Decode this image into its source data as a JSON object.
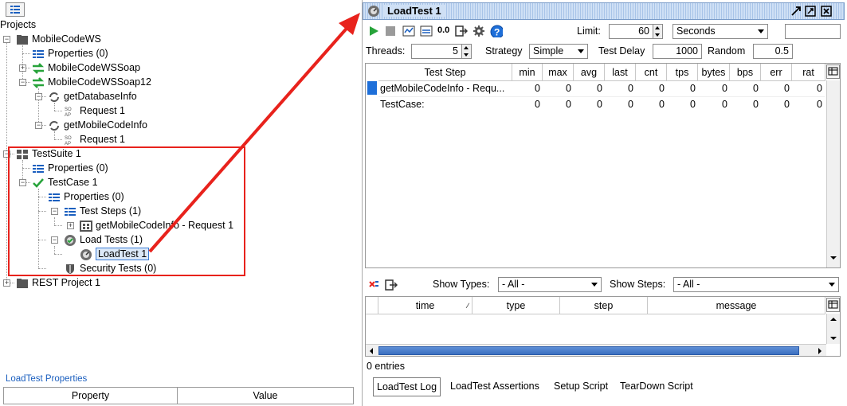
{
  "left": {
    "projects_label": "Projects",
    "tree": [
      {
        "label": "MobileCodeWS",
        "icon": "folder-icon"
      },
      {
        "label": "Properties (0)",
        "icon": "properties-icon"
      },
      {
        "label": "MobileCodeWSSoap",
        "icon": "interface-icon"
      },
      {
        "label": "MobileCodeWSSoap12",
        "icon": "interface-icon"
      },
      {
        "label": "getDatabaseInfo",
        "icon": "operation-icon"
      },
      {
        "label": "Request 1",
        "icon": "soap-request-icon"
      },
      {
        "label": "getMobileCodeInfo",
        "icon": "operation-icon"
      },
      {
        "label": "Request 1",
        "icon": "soap-request-icon"
      },
      {
        "label": "TestSuite 1",
        "icon": "testsuite-icon"
      },
      {
        "label": "Properties (0)",
        "icon": "properties-icon"
      },
      {
        "label": "TestCase 1",
        "icon": "check-icon"
      },
      {
        "label": "Properties (0)",
        "icon": "properties-icon"
      },
      {
        "label": "Test Steps (1)",
        "icon": "properties-icon"
      },
      {
        "label": "getMobileCodeInfo - Request 1",
        "icon": "teststep-icon"
      },
      {
        "label": "Load Tests (1)",
        "icon": "loadtests-icon"
      },
      {
        "label": "LoadTest 1",
        "icon": "loadtest-icon"
      },
      {
        "label": "Security Tests (0)",
        "icon": "shield-icon"
      },
      {
        "label": "REST Project 1",
        "icon": "folder-icon"
      }
    ],
    "props_title": "LoadTest Properties",
    "props_cols": [
      "Property",
      "Value"
    ]
  },
  "right": {
    "title": "LoadTest 1",
    "toolbar": {
      "zero_label": "0.0",
      "limit_label": "Limit:",
      "limit_value": "60",
      "limit_unit": "Seconds",
      "extra_value": ""
    },
    "config": {
      "threads_label": "Threads:",
      "threads_value": "5",
      "strategy_label": "Strategy",
      "strategy_value": "Simple",
      "delay_label": "Test Delay",
      "delay_value": "1000",
      "random_label": "Random",
      "random_value": "0.5"
    },
    "stats": {
      "columns": [
        "Test Step",
        "min",
        "max",
        "avg",
        "last",
        "cnt",
        "tps",
        "bytes",
        "bps",
        "err",
        "rat"
      ],
      "rows": [
        {
          "name": "getMobileCodeInfo - Requ...",
          "vals": [
            "0",
            "0",
            "0",
            "0",
            "0",
            "0",
            "0",
            "0",
            "0",
            "0"
          ]
        },
        {
          "name": "TestCase:",
          "vals": [
            "0",
            "0",
            "0",
            "0",
            "0",
            "0",
            "0",
            "0",
            "0",
            "0"
          ]
        }
      ]
    },
    "log": {
      "show_types_label": "Show Types:",
      "show_types_value": "- All -",
      "show_steps_label": "Show Steps:",
      "show_steps_value": "- All -",
      "columns": [
        "time",
        "type",
        "step",
        "message"
      ],
      "entries_label": "0 entries"
    },
    "tabs": [
      "LoadTest Log",
      "LoadTest Assertions",
      "Setup Script",
      "TearDown Script"
    ],
    "colors": {
      "highlight_red": "#e8221c",
      "accent_blue": "#1e6fd9"
    }
  }
}
